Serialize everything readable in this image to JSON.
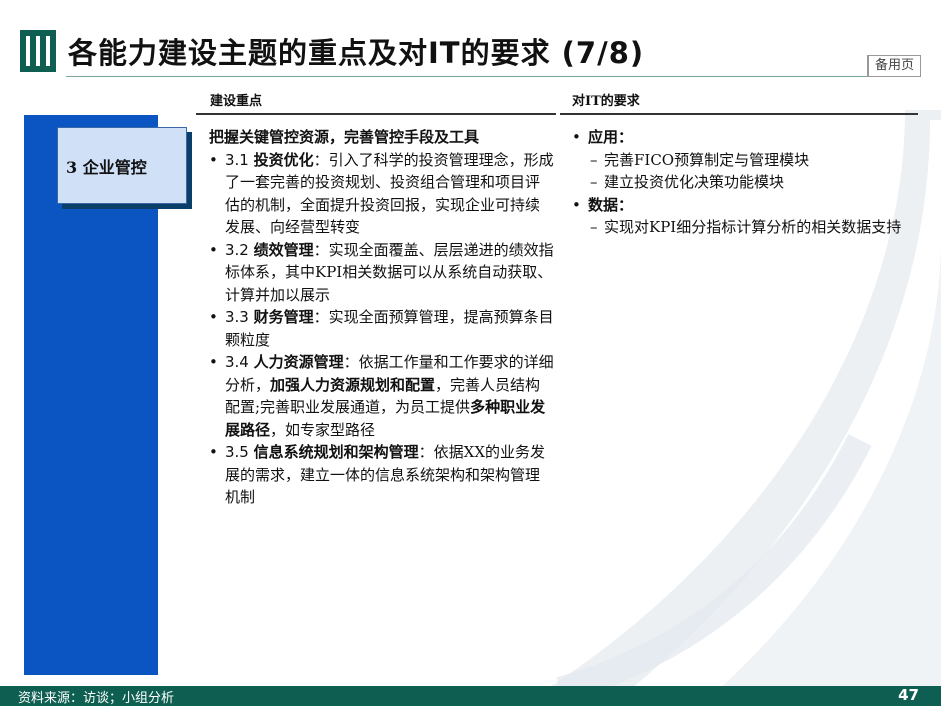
{
  "header": {
    "title": "各能力建设主题的重点及对IT的要求 (7/8)",
    "tag": "备用页"
  },
  "columns": {
    "left_heading": "建设重点",
    "right_heading": "对IT的要求"
  },
  "category": {
    "label": "3 企业管控"
  },
  "focus": {
    "lead": "把握关键管控资源，完善管控手段及工具",
    "items": [
      {
        "num": "3.1 ",
        "parts": [
          {
            "t": "投资优化",
            "b": true
          },
          {
            "t": "：引入了科学的投资管理理念，形成了一套完善的投资规划、投资组合管理和项目评估的机制，全面提升投资回报，实现企业可持续发展、向经营型转变",
            "b": false
          }
        ]
      },
      {
        "num": "3.2 ",
        "parts": [
          {
            "t": "绩效管理",
            "b": true
          },
          {
            "t": "：实现全面覆盖、层层递进的绩效指标体系，其中KPI相关数据可以从系统自动获取、计算并加以展示",
            "b": false
          }
        ]
      },
      {
        "num": "3.3 ",
        "parts": [
          {
            "t": "财务管理",
            "b": true
          },
          {
            "t": "：实现全面预算管理，提高预算条目颗粒度",
            "b": false
          }
        ]
      },
      {
        "num": "3.4 ",
        "parts": [
          {
            "t": "人力资源管理",
            "b": true
          },
          {
            "t": "：依据工作量和工作要求的详细分析，",
            "b": false
          },
          {
            "t": "加强人力资源规划和配置",
            "b": true
          },
          {
            "t": "，完善人员结构配置;完善职业发展通道，为员工提供",
            "b": false
          },
          {
            "t": "多种职业发展路径",
            "b": true
          },
          {
            "t": "，如专家型路径",
            "b": false
          }
        ]
      },
      {
        "num": "3.5 ",
        "parts": [
          {
            "t": "信息系统规划和架构管理",
            "b": true
          },
          {
            "t": "：依据XX的业务发展的需求，建立一体的信息系统架构和架构管理机制",
            "b": false
          }
        ]
      }
    ]
  },
  "it_requirements": [
    {
      "label": "应用：",
      "subs": [
        "完善FICO预算制定与管理模块",
        "建立投资优化决策功能模块"
      ]
    },
    {
      "label": "数据：",
      "subs": [
        "实现对KPI细分指标计算分析的相关数据支持"
      ]
    }
  ],
  "footer": {
    "source": "资料来源：访谈；小组分析",
    "page": "47"
  },
  "colors": {
    "brand_green": "#0e5f52",
    "blue_bar": "#0b55c2",
    "category_fill": "#cfe0f7"
  }
}
